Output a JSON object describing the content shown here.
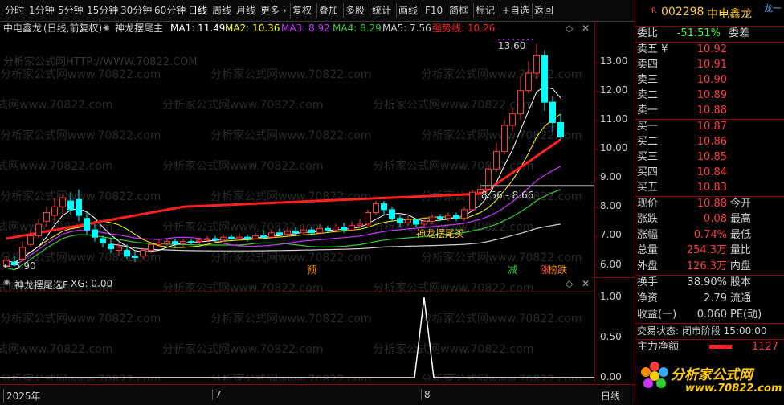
{
  "toolbar": {
    "items": [
      "分时",
      "1分钟",
      "5分钟",
      "15分钟",
      "30分钟",
      "60分钟",
      "日线",
      "周线",
      "月线",
      "更多 ›",
      "复权",
      "叠加",
      "多股",
      "统计",
      "画线",
      "F10",
      "简框",
      "标记",
      "+自选",
      "返回"
    ],
    "active": "日线"
  },
  "info": {
    "stock": "中电鑫龙",
    "mode": "(日线,前复权)",
    "indicator": "神龙摆尾主",
    "ma1": "MA1: 11.49",
    "ma2": "MA2: 10.36",
    "ma3": "MA3: 8.92",
    "ma4": "MA4: 8.29",
    "ma5": "MA5: 7.56",
    "strong": "强势线: 10.26"
  },
  "colors": {
    "up": "#ff3b3b",
    "down": "#00ffff",
    "ma1": "#ffffff",
    "ma2": "#ffff00",
    "ma3": "#cc33ff",
    "ma4": "#33cc33",
    "ma5": "#d0d0d0",
    "strong": "#ff2020",
    "highlight": "#ffcc33"
  },
  "chart_data": {
    "type": "candlestick",
    "y_ticks": [
      "13.00",
      "12.00",
      "11.00",
      "10.00",
      "9.00",
      "8.00",
      "7.00",
      "6.00"
    ],
    "ylim": [
      5.6,
      13.9
    ],
    "high_label": "13.60",
    "low_label": "5.90",
    "range_label": "8.56 - 8.66",
    "candles": [
      {
        "o": 5.95,
        "c": 6.15,
        "h": 6.3,
        "l": 5.9
      },
      {
        "o": 6.1,
        "c": 6.0,
        "h": 6.3,
        "l": 5.95
      },
      {
        "o": 6.2,
        "c": 6.6,
        "h": 6.8,
        "l": 6.1
      },
      {
        "o": 6.7,
        "c": 7.0,
        "h": 7.2,
        "l": 6.6
      },
      {
        "o": 7.0,
        "c": 7.4,
        "h": 7.6,
        "l": 6.9
      },
      {
        "o": 7.5,
        "c": 7.8,
        "h": 8.0,
        "l": 7.3
      },
      {
        "o": 7.7,
        "c": 8.0,
        "h": 8.3,
        "l": 7.5
      },
      {
        "o": 8.0,
        "c": 8.3,
        "h": 8.4,
        "l": 7.7
      },
      {
        "o": 8.2,
        "c": 7.9,
        "h": 8.5,
        "l": 7.7
      },
      {
        "o": 8.25,
        "c": 7.7,
        "h": 8.6,
        "l": 7.5
      },
      {
        "o": 7.6,
        "c": 7.2,
        "h": 7.8,
        "l": 7.0
      },
      {
        "o": 7.2,
        "c": 6.95,
        "h": 7.4,
        "l": 6.8
      },
      {
        "o": 6.9,
        "c": 6.75,
        "h": 7.0,
        "l": 6.6
      },
      {
        "o": 6.7,
        "c": 6.55,
        "h": 6.9,
        "l": 6.4
      },
      {
        "o": 6.5,
        "c": 6.6,
        "h": 6.8,
        "l": 6.3
      },
      {
        "o": 6.5,
        "c": 6.3,
        "h": 6.7,
        "l": 6.2
      },
      {
        "o": 6.3,
        "c": 6.25,
        "h": 6.5,
        "l": 6.1
      },
      {
        "o": 6.3,
        "c": 6.5,
        "h": 6.6,
        "l": 6.2
      },
      {
        "o": 6.5,
        "c": 6.7,
        "h": 6.8,
        "l": 6.4
      },
      {
        "o": 6.7,
        "c": 6.75,
        "h": 6.85,
        "l": 6.6
      },
      {
        "o": 6.75,
        "c": 6.8,
        "h": 6.9,
        "l": 6.65
      },
      {
        "o": 6.8,
        "c": 6.72,
        "h": 6.9,
        "l": 6.6
      },
      {
        "o": 6.72,
        "c": 6.8,
        "h": 6.9,
        "l": 6.6
      },
      {
        "o": 6.8,
        "c": 6.78,
        "h": 6.9,
        "l": 6.7
      },
      {
        "o": 6.8,
        "c": 6.85,
        "h": 6.95,
        "l": 6.7
      },
      {
        "o": 6.85,
        "c": 6.9,
        "h": 7.0,
        "l": 6.8
      },
      {
        "o": 6.9,
        "c": 6.85,
        "h": 7.0,
        "l": 6.8
      },
      {
        "o": 6.85,
        "c": 6.95,
        "h": 7.05,
        "l": 6.8
      },
      {
        "o": 6.95,
        "c": 6.9,
        "h": 7.05,
        "l": 6.85
      },
      {
        "o": 6.9,
        "c": 6.95,
        "h": 7.1,
        "l": 6.85
      },
      {
        "o": 6.95,
        "c": 6.9,
        "h": 7.05,
        "l": 6.8
      },
      {
        "o": 6.9,
        "c": 7.0,
        "h": 7.1,
        "l": 6.85
      },
      {
        "o": 7.0,
        "c": 6.95,
        "h": 7.2,
        "l": 6.9
      },
      {
        "o": 6.95,
        "c": 7.1,
        "h": 7.2,
        "l": 6.9
      },
      {
        "o": 7.1,
        "c": 7.05,
        "h": 7.25,
        "l": 7.0
      },
      {
        "o": 7.05,
        "c": 7.15,
        "h": 7.3,
        "l": 7.0
      },
      {
        "o": 7.15,
        "c": 7.1,
        "h": 7.3,
        "l": 7.0
      },
      {
        "o": 7.1,
        "c": 7.2,
        "h": 7.35,
        "l": 7.05
      },
      {
        "o": 7.2,
        "c": 7.1,
        "h": 7.3,
        "l": 7.0
      },
      {
        "o": 7.1,
        "c": 7.25,
        "h": 7.4,
        "l": 7.05
      },
      {
        "o": 7.25,
        "c": 7.2,
        "h": 7.35,
        "l": 7.1
      },
      {
        "o": 7.2,
        "c": 7.3,
        "h": 7.4,
        "l": 7.1
      },
      {
        "o": 7.3,
        "c": 7.2,
        "h": 7.45,
        "l": 7.1
      },
      {
        "o": 7.2,
        "c": 7.35,
        "h": 7.5,
        "l": 7.15
      },
      {
        "o": 7.35,
        "c": 7.4,
        "h": 7.6,
        "l": 7.3
      },
      {
        "o": 7.4,
        "c": 7.8,
        "h": 7.9,
        "l": 7.3
      },
      {
        "o": 7.8,
        "c": 8.1,
        "h": 8.2,
        "l": 7.7
      },
      {
        "o": 8.1,
        "c": 7.9,
        "h": 8.2,
        "l": 7.7
      },
      {
        "o": 7.9,
        "c": 7.6,
        "h": 8.0,
        "l": 7.5
      },
      {
        "o": 7.6,
        "c": 7.45,
        "h": 7.7,
        "l": 7.3
      },
      {
        "o": 7.45,
        "c": 7.55,
        "h": 7.7,
        "l": 7.35
      },
      {
        "o": 7.55,
        "c": 7.4,
        "h": 7.6,
        "l": 7.3
      },
      {
        "o": 7.4,
        "c": 7.5,
        "h": 7.65,
        "l": 7.3
      },
      {
        "o": 7.5,
        "c": 7.65,
        "h": 7.75,
        "l": 7.4
      },
      {
        "o": 7.65,
        "c": 7.6,
        "h": 7.75,
        "l": 7.5
      },
      {
        "o": 7.6,
        "c": 7.7,
        "h": 7.8,
        "l": 7.5
      },
      {
        "o": 7.7,
        "c": 7.6,
        "h": 7.8,
        "l": 7.5
      },
      {
        "o": 7.6,
        "c": 7.9,
        "h": 8.0,
        "l": 7.5
      },
      {
        "o": 7.9,
        "c": 8.5,
        "h": 8.6,
        "l": 7.85
      },
      {
        "o": 8.5,
        "c": 8.6,
        "h": 8.7,
        "l": 8.4
      },
      {
        "o": 8.6,
        "c": 9.3,
        "h": 9.4,
        "l": 8.6
      },
      {
        "o": 9.3,
        "c": 9.9,
        "h": 10.2,
        "l": 9.2
      },
      {
        "o": 9.9,
        "c": 10.8,
        "h": 11.0,
        "l": 9.8
      },
      {
        "o": 10.8,
        "c": 11.2,
        "h": 11.4,
        "l": 10.6
      },
      {
        "o": 11.2,
        "c": 12.0,
        "h": 12.5,
        "l": 11.0
      },
      {
        "o": 12.0,
        "c": 12.6,
        "h": 13.0,
        "l": 11.9
      },
      {
        "o": 12.6,
        "c": 13.2,
        "h": 13.6,
        "l": 12.4
      },
      {
        "o": 13.2,
        "c": 11.6,
        "h": 13.4,
        "l": 11.3
      },
      {
        "o": 11.6,
        "c": 10.9,
        "h": 11.8,
        "l": 10.6
      },
      {
        "o": 10.9,
        "c": 10.4,
        "h": 11.2,
        "l": 10.3
      }
    ],
    "markers": [
      {
        "i": 38,
        "text": "预",
        "color": "#ff8800"
      },
      {
        "i": 63,
        "text": "减",
        "color": "#33cc33"
      },
      {
        "i": 67,
        "text": "涨",
        "color": "#ff3b3b"
      },
      {
        "i": 68,
        "text": "榜跌",
        "color": "#ff8800"
      }
    ],
    "signal_label": "神龙摆尾买",
    "sub_title": "神龙摆尾选F",
    "sub_value": "XG: 0.00",
    "sub_y_ticks": [
      "1.00",
      "0.50",
      "0.00"
    ],
    "sub_spike_index": 52,
    "x_labels": [
      {
        "i": 0,
        "text": "2025年"
      },
      {
        "i": 26,
        "text": "7"
      },
      {
        "i": 52,
        "text": "8"
      }
    ]
  },
  "watermark": "分析家公式网www.70822.com",
  "watermark_top": "分析家公式网HTTP://WWW.70822.COM",
  "bottom_right": "日线",
  "panel": {
    "badge": "R",
    "code": "002298",
    "name": "中电鑫龙",
    "corner": "龙一",
    "weibi_label": "委比",
    "weibi_value": "-51.51%",
    "weicha_label": "委差",
    "sell": [
      {
        "label": "卖五 ¥",
        "price": "10.92"
      },
      {
        "label": "卖四",
        "price": "10.91"
      },
      {
        "label": "卖三",
        "price": "10.90"
      },
      {
        "label": "卖二",
        "price": "10.89"
      },
      {
        "label": "卖一",
        "price": "10.88"
      }
    ],
    "buy": [
      {
        "label": "买一",
        "price": "10.87"
      },
      {
        "label": "买二",
        "price": "10.86"
      },
      {
        "label": "买三",
        "price": "10.85"
      },
      {
        "label": "买四",
        "price": "10.84"
      },
      {
        "label": "买五",
        "price": "10.83"
      }
    ],
    "stats": [
      {
        "l": "现价",
        "v": "10.88",
        "r": "今开"
      },
      {
        "l": "涨跌",
        "v": "0.08",
        "r": "最高"
      },
      {
        "l": "涨幅",
        "v": "0.74%",
        "r": "最低"
      },
      {
        "l": "总量",
        "v": "254.3万",
        "r": "量比"
      },
      {
        "l": "外盘",
        "v": "126.3万",
        "r": "内盘"
      }
    ],
    "stats2": [
      {
        "l": "换手",
        "v": "38.90%",
        "r": "股本"
      },
      {
        "l": "净资",
        "v": "2.79",
        "r": "流通"
      },
      {
        "l": "收益(一)",
        "v": "0.060",
        "r": "PE(动)"
      }
    ],
    "trade_status": "交易状态: 闭市阶段 15:00:00",
    "mainforce_label": "主力净额",
    "mainforce_value": "1127",
    "logo_text": "分析家公式网",
    "logo_url": "www.70822.com"
  }
}
